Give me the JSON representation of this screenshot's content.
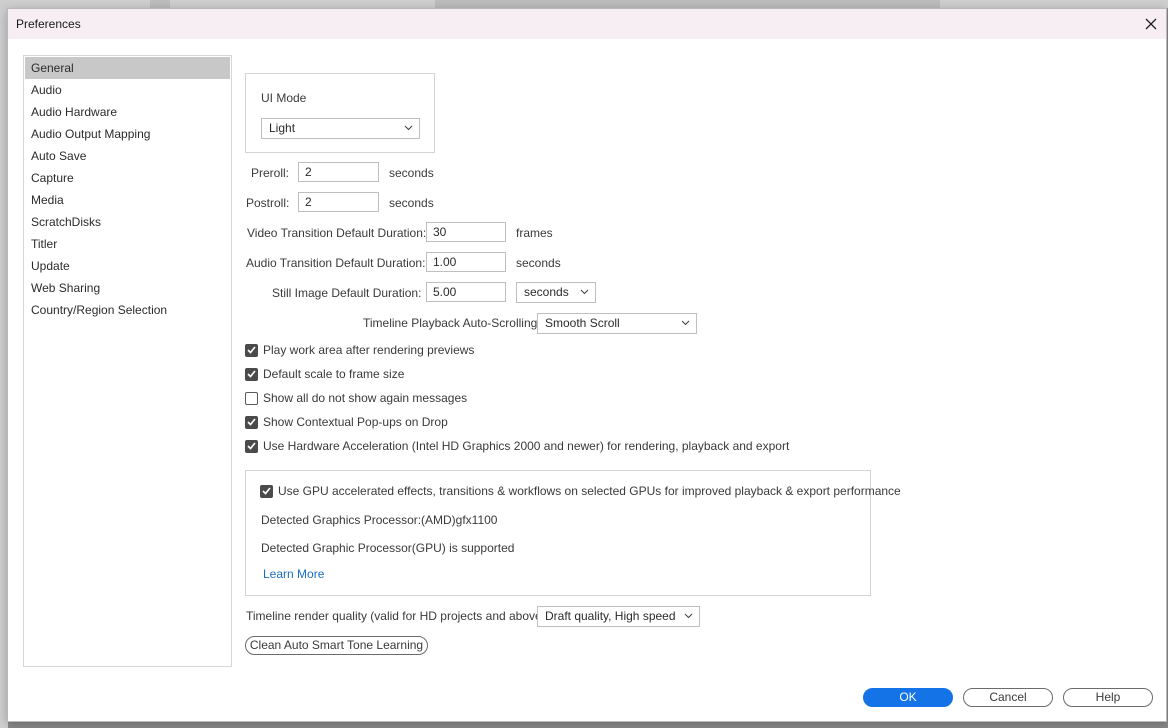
{
  "dialog": {
    "title": "Preferences"
  },
  "sidebar": {
    "items": [
      {
        "label": "General",
        "active": true
      },
      {
        "label": "Audio"
      },
      {
        "label": "Audio Hardware"
      },
      {
        "label": "Audio Output Mapping"
      },
      {
        "label": "Auto Save"
      },
      {
        "label": "Capture"
      },
      {
        "label": "Media"
      },
      {
        "label": "ScratchDisks"
      },
      {
        "label": "Titler"
      },
      {
        "label": "Update"
      },
      {
        "label": "Web Sharing"
      },
      {
        "label": "Country/Region Selection"
      }
    ]
  },
  "general": {
    "ui_mode_label": "UI Mode",
    "ui_mode_value": "Light",
    "preroll_label": "Preroll:",
    "preroll_value": "2",
    "preroll_unit": "seconds",
    "postroll_label": "Postroll:",
    "postroll_value": "2",
    "postroll_unit": "seconds",
    "video_transition_label": "Video Transition Default Duration:",
    "video_transition_value": "30",
    "video_transition_unit": "frames",
    "audio_transition_label": "Audio Transition Default Duration:",
    "audio_transition_value": "1.00",
    "audio_transition_unit": "seconds",
    "still_image_label": "Still Image Default Duration:",
    "still_image_value": "5.00",
    "still_image_unit": "seconds",
    "autoscroll_label": "Timeline Playback Auto-Scrolling:",
    "autoscroll_value": "Smooth Scroll",
    "checkboxes": [
      {
        "label": "Play work area after rendering previews",
        "checked": true
      },
      {
        "label": "Default scale to frame size",
        "checked": true
      },
      {
        "label": "Show all do not show again messages",
        "checked": false
      },
      {
        "label": "Show Contextual Pop-ups on Drop",
        "checked": true
      },
      {
        "label": "Use Hardware Acceleration (Intel HD Graphics 2000 and newer) for rendering, playback and export",
        "checked": true
      }
    ],
    "gpu": {
      "checkbox_label": "Use GPU accelerated effects, transitions & workflows on selected GPUs for improved playback & export performance",
      "checked": true,
      "detected_label": "Detected Graphics Processor:",
      "detected_value": "(AMD)gfx1100",
      "supported_text": "Detected Graphic Processor(GPU) is supported",
      "learn_more": "Learn More"
    },
    "render_quality_label": "Timeline render quality (valid for HD projects and above):",
    "render_quality_value": "Draft quality, High speed",
    "clean_button": "Clean Auto Smart Tone Learning"
  },
  "footer": {
    "ok": "OK",
    "cancel": "Cancel",
    "help": "Help"
  },
  "colors": {
    "accent": "#1473e6",
    "titlebar": "#f6eef3",
    "link": "#1a6cc0",
    "sidebar_active": "#c8c8c8"
  },
  "icons": {
    "close": "close-icon",
    "chevron": "chevron-down-icon",
    "check": "checkmark-icon"
  }
}
